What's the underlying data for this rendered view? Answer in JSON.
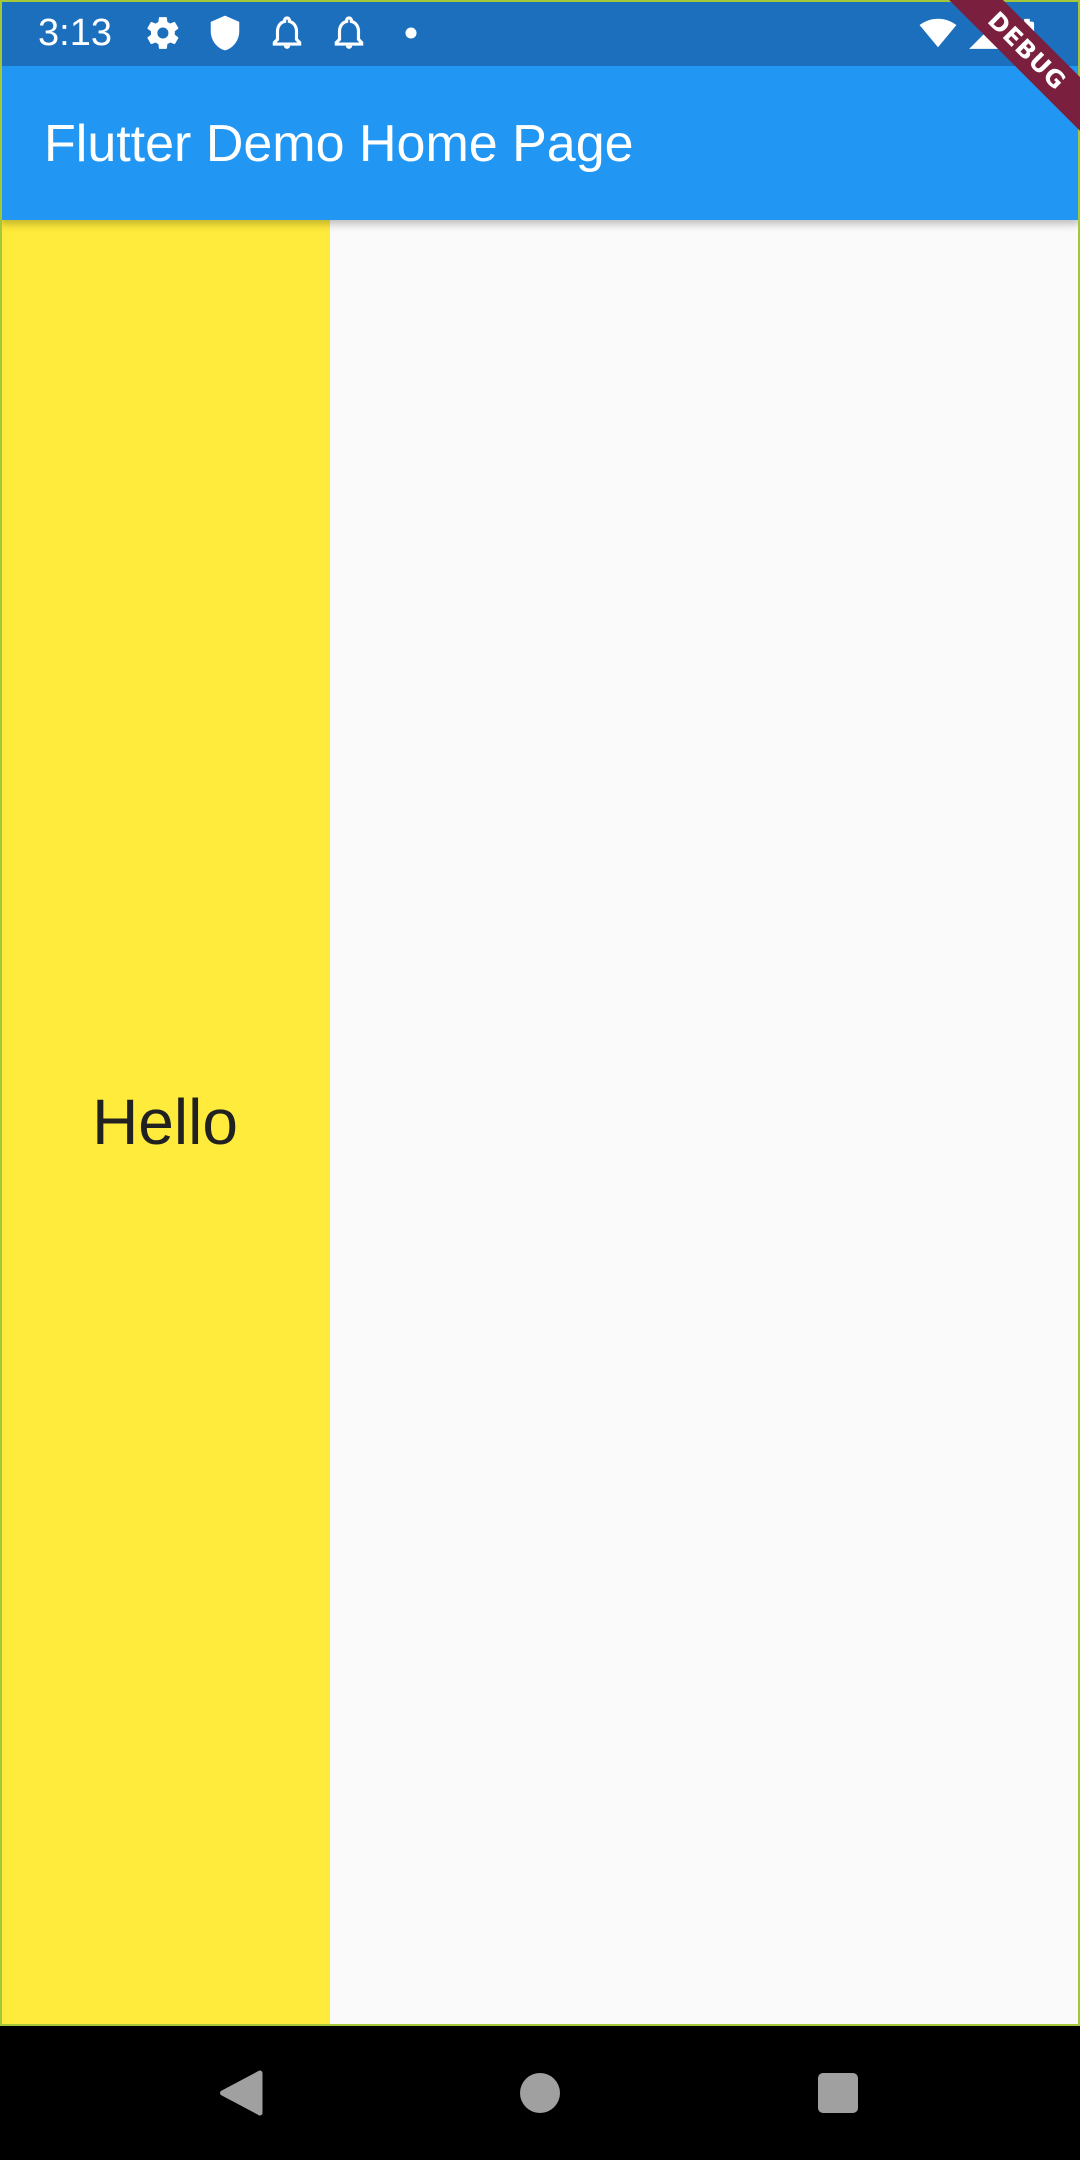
{
  "status_bar": {
    "time": "3:13",
    "left_icons": [
      "gear-icon",
      "shield-icon",
      "bell-icon",
      "bell-icon",
      "dot-icon"
    ],
    "right_icons": [
      "wifi-icon",
      "signal-icon",
      "battery-icon"
    ]
  },
  "app_bar": {
    "title": "Flutter Demo Home Page"
  },
  "debug_banner": {
    "label": "DEBUG"
  },
  "content": {
    "panel_text": "Hello"
  },
  "nav_bar": {
    "buttons": [
      "back-icon",
      "home-icon",
      "recents-icon"
    ]
  },
  "colors": {
    "status_bar": "#1b6fbd",
    "app_bar": "#2196f3",
    "yellow_panel": "#ffeb3b",
    "background": "#fafafa",
    "debug_banner": "#7a1f3d",
    "nav_bar": "#000000"
  }
}
